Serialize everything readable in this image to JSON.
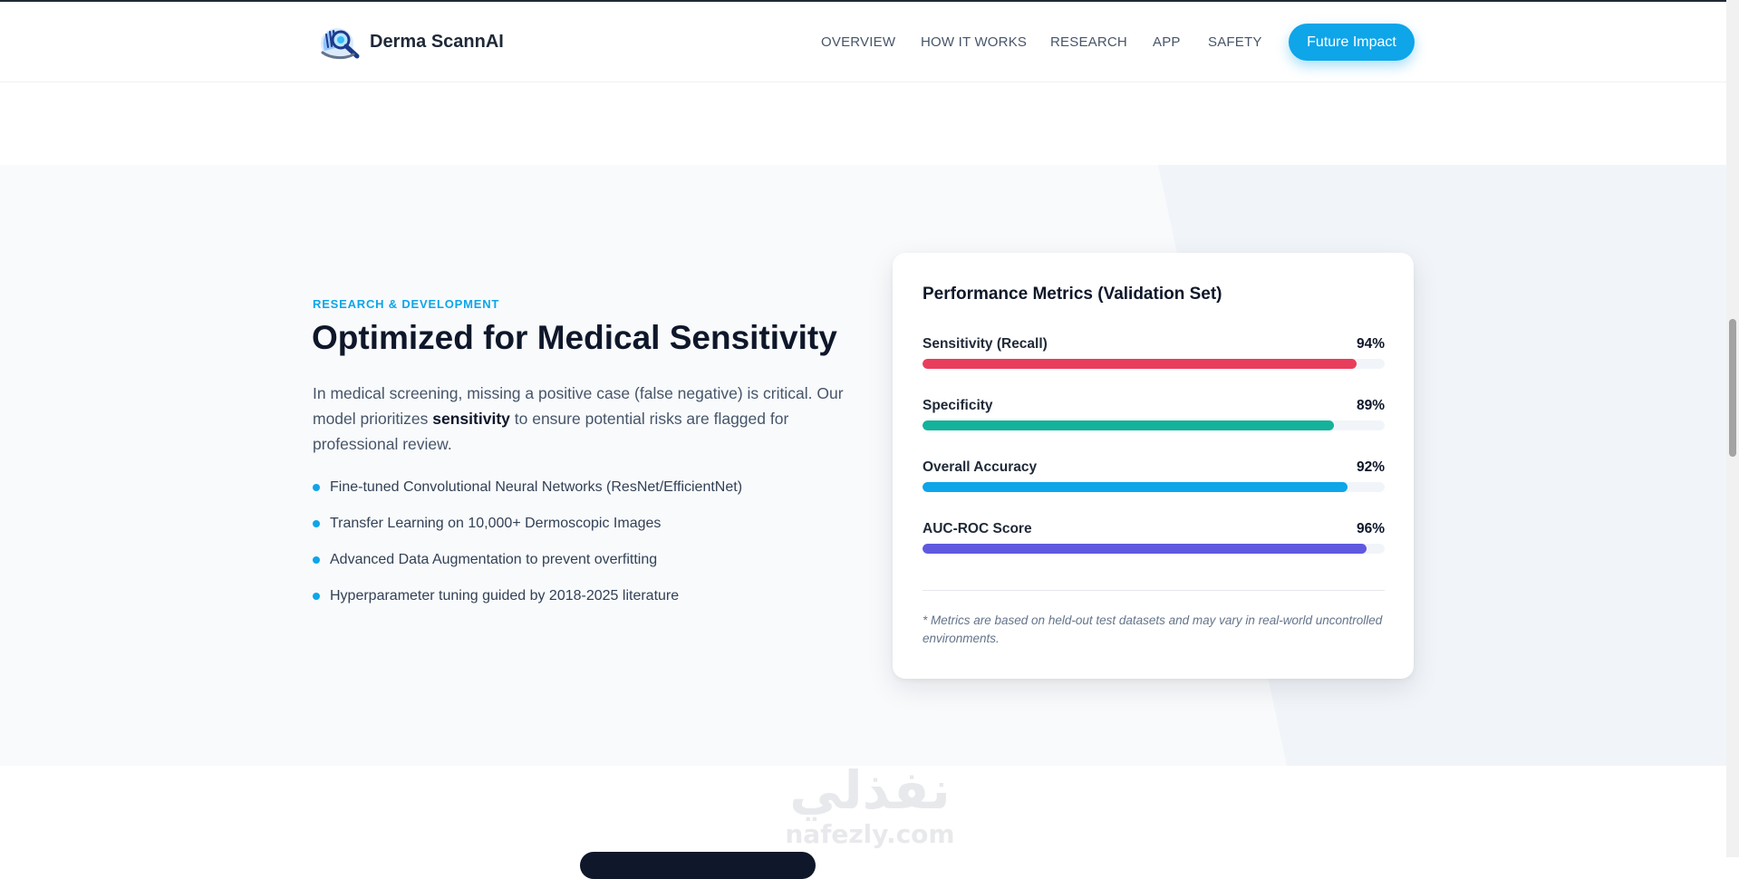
{
  "header": {
    "brand": "Derma ScannAI",
    "logo_icon": "magnifier-hand-icon",
    "nav": [
      "OVERVIEW",
      "HOW IT WORKS",
      "RESEARCH",
      "APP",
      "SAFETY"
    ],
    "cta_label": "Future Impact"
  },
  "research": {
    "eyebrow": "RESEARCH & DEVELOPMENT",
    "heading": "Optimized for Medical Sensitivity",
    "lead_before": "In medical screening, missing a positive case (false negative) is critical. Our model prioritizes ",
    "lead_bold": "sensitivity",
    "lead_after": " to ensure potential risks are flagged for professional review.",
    "features": [
      "Fine-tuned Convolutional Neural Networks (ResNet/EfficientNet)",
      "Transfer Learning on 10,000+ Dermoscopic Images",
      "Advanced Data Augmentation to prevent overfitting",
      "Hyperparameter tuning guided by 2018-2025 literature"
    ],
    "bullet_color": "#0ea5e9"
  },
  "metrics": {
    "title": "Performance Metrics (Validation Set)",
    "items": [
      {
        "label": "Sensitivity (Recall)",
        "value": "94%",
        "fraction": 0.94,
        "color": "#e83e5c"
      },
      {
        "label": "Specificity",
        "value": "89%",
        "fraction": 0.89,
        "color": "#14b29a"
      },
      {
        "label": "Overall Accuracy",
        "value": "92%",
        "fraction": 0.92,
        "color": "#0ea5e9"
      },
      {
        "label": "AUC-ROC Score",
        "value": "96%",
        "fraction": 0.96,
        "color": "#6059e0"
      }
    ],
    "note": "* Metrics are based on held-out test datasets and may vary in real-world uncontrolled environments."
  },
  "watermark": {
    "arabic": "نفذلي",
    "latin": "nafezly.com"
  },
  "colors": {
    "accent": "#0ea5e9",
    "heading": "#0f172a",
    "section_bg": "#f8fafc"
  }
}
